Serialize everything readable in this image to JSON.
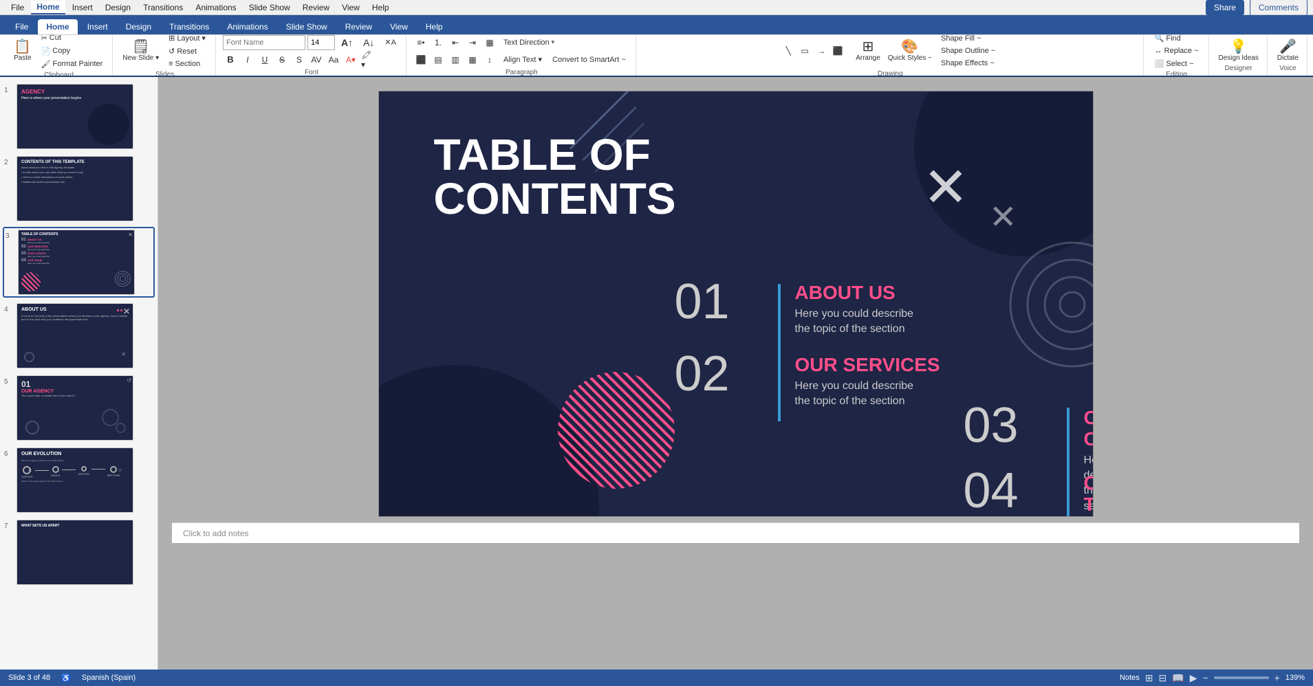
{
  "menubar": {
    "items": [
      "File",
      "Home",
      "Insert",
      "Design",
      "Transitions",
      "Animations",
      "Slide Show",
      "Review",
      "View",
      "Help"
    ],
    "active": "Home",
    "top_right": {
      "share": "Share",
      "comments": "Comments"
    }
  },
  "ribbon": {
    "groups": [
      {
        "name": "Clipboard",
        "items": [
          "Cut",
          "Copy",
          "Format Painter",
          "Paste"
        ]
      },
      {
        "name": "Slides",
        "items": [
          "New Slide",
          "Layout",
          "Reset",
          "Section"
        ]
      },
      {
        "name": "Font",
        "items": []
      },
      {
        "name": "Paragraph",
        "items": []
      },
      {
        "name": "Drawing",
        "items": []
      },
      {
        "name": "Editing",
        "items": [
          "Find",
          "Replace",
          "Select"
        ]
      },
      {
        "name": "Designer",
        "items": [
          "Design Ideas"
        ]
      },
      {
        "name": "Voice",
        "items": [
          "Dictate"
        ]
      }
    ],
    "font_name": "",
    "font_size": "14",
    "bold": "B",
    "italic": "I",
    "underline": "U",
    "text_direction_label": "Text Direction",
    "align_text_label": "Align Text ~",
    "convert_label": "Convert to SmartArt ~",
    "shape_fill_label": "Shape Fill ~",
    "shape_outline_label": "Shape Outline ~",
    "shape_effects_label": "Shape Effects ~",
    "arrange_label": "Arrange",
    "quick_styles_label": "Quick Styles ~",
    "find_label": "Find",
    "replace_label": "Replace ~",
    "select_label": "Select ~",
    "design_ideas_label": "Design Ideas",
    "dictate_label": "Dictate",
    "section_label": "Section"
  },
  "slides": [
    {
      "num": "1",
      "label": "AGENCY"
    },
    {
      "num": "2",
      "label": "CONTENTS OF THIS TEMPLATE"
    },
    {
      "num": "3",
      "label": "TABLE OF CONTENTS",
      "active": true
    },
    {
      "num": "4",
      "label": "ABOUT US"
    },
    {
      "num": "5",
      "label": "OUR AGENCY"
    },
    {
      "num": "6",
      "label": "OUR EVOLUTION"
    },
    {
      "num": "7",
      "label": "WHAT SETS US APART"
    }
  ],
  "slide": {
    "bg_color": "#1e2545",
    "title_line1": "TABLE OF",
    "title_line2": "CONTENTS",
    "items": [
      {
        "num": "01",
        "title": "ABOUT US",
        "desc_line1": "Here you could describe",
        "desc_line2": "the topic of the section"
      },
      {
        "num": "02",
        "title": "OUR SERVICES",
        "desc_line1": "Here you could describe",
        "desc_line2": "the topic of the section"
      },
      {
        "num": "03",
        "title": "OUR CLIENTS",
        "desc_line1": "Here you could describe",
        "desc_line2": "the topic of the section"
      },
      {
        "num": "04",
        "title": "OUR TEAM",
        "desc_line1": "Here you could describe",
        "desc_line2": "the topic of the section"
      }
    ]
  },
  "notes": {
    "placeholder": "Click to add notes"
  },
  "status": {
    "slide_info": "Slide 3 of 48",
    "language": "Spanish (Spain)",
    "zoom": "139%",
    "notes_label": "Notes",
    "view_labels": [
      "Normal",
      "Slide Sorter",
      "Reading View",
      "Slide Show"
    ]
  }
}
